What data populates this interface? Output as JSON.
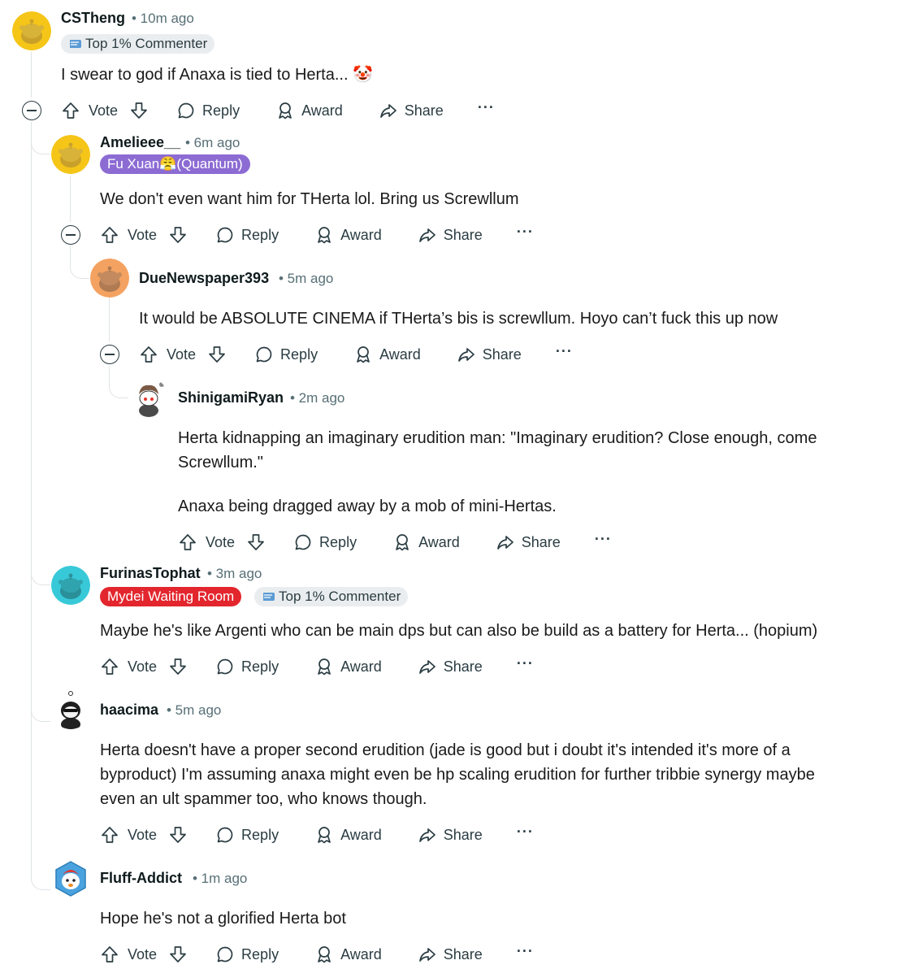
{
  "comments": [
    {
      "username": "CSTheng",
      "time": "• 10m ago",
      "flairs": [
        {
          "text": "Top 1% Commenter",
          "style": "gray",
          "icon": "commenter-badge-icon"
        }
      ],
      "body": [
        "I swear to god if Anaxa is tied to Herta... 🤡"
      ],
      "avatar_color": "#f5c518"
    },
    {
      "username": "Amelieee__",
      "time": "• 6m ago",
      "flairs": [
        {
          "text": "Fu Xuan😤(Quantum)",
          "style": "purple"
        }
      ],
      "body": [
        "We don't even want him for THerta lol. Bring us Screwllum"
      ],
      "avatar_color": "#f5c518"
    },
    {
      "username": "DueNewspaper393",
      "time": "• 5m ago",
      "body": [
        "It would be ABSOLUTE CINEMA if THerta’s bis is screwllum. Hoyo can’t fuck this up now"
      ],
      "avatar_color": "#f4a261"
    },
    {
      "username": "ShinigamiRyan",
      "time": "• 2m ago",
      "body": [
        "Herta kidnapping an imaginary erudition man: \"Imaginary erudition? Close enough, come",
        "Screwllum.\"",
        "",
        "Anaxa being dragged away by a mob of mini-Hertas."
      ],
      "avatar_color": "#ffffff"
    },
    {
      "username": "FurinasTophat",
      "time": "• 3m ago",
      "flairs": [
        {
          "text": "Mydei Waiting Room",
          "style": "red"
        },
        {
          "text": "Top 1% Commenter",
          "style": "gray",
          "icon": "commenter-badge-icon"
        }
      ],
      "body": [
        "Maybe he's like Argenti who can be main dps but can also be build as a battery for Herta... (hopium)"
      ],
      "avatar_color": "#38c9d8"
    },
    {
      "username": "haacima",
      "time": "• 5m ago",
      "body": [
        "Herta doesn't have a proper second erudition (jade is good but i doubt it's intended it's more of a",
        "byproduct) I'm assuming anaxa might even be hp scaling erudition for further tribbie synergy maybe",
        "even an ult spammer too, who knows though."
      ],
      "avatar_color": "#ffffff"
    },
    {
      "username": "Fluff-Addict",
      "time": "• 1m ago",
      "body": [
        "Hope he's not a glorified Herta bot"
      ],
      "avatar_color": "#4aa3df"
    }
  ],
  "actions": {
    "vote": "Vote",
    "reply": "Reply",
    "award": "Award",
    "share": "Share",
    "more": "···"
  },
  "colors": {
    "flair_gray": "#eaedef",
    "flair_purple": "#8c6bd3",
    "flair_red": "#e3262e",
    "thread_line": "#dfe3e6",
    "meta_text": "#576f76"
  }
}
